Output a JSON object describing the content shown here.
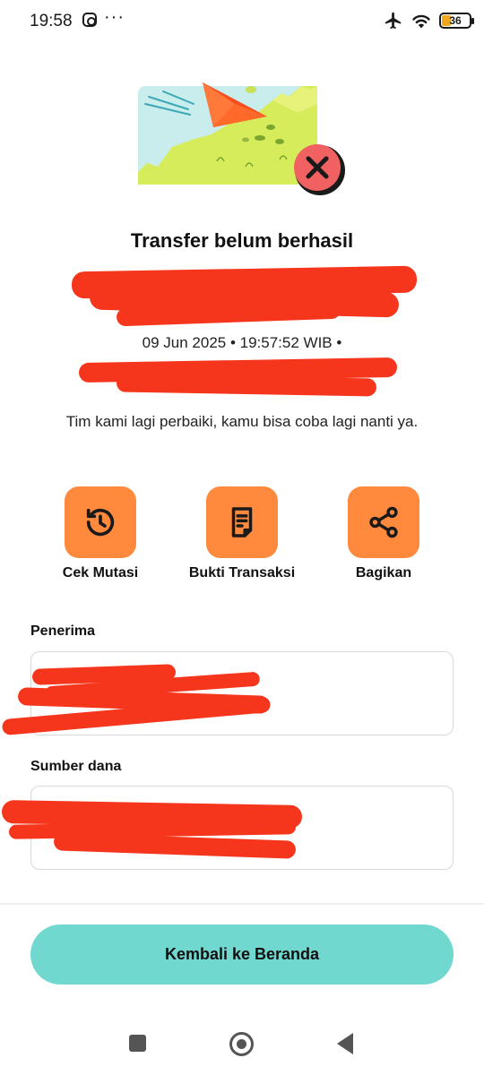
{
  "status_bar": {
    "time": "19:58",
    "overflow": "···",
    "battery": "36",
    "icons": [
      "instagram-icon",
      "airplane-mode-icon",
      "wifi-icon",
      "battery-icon"
    ]
  },
  "result": {
    "title": "Transfer belum berhasil",
    "datetime": "09 Jun 2025 • 19:57:52 WIB •",
    "message": "Tim kami lagi perbaiki, kamu bisa coba lagi nanti ya.",
    "status_icon": "close-icon"
  },
  "actions": [
    {
      "label": "Cek Mutasi",
      "icon": "history-icon"
    },
    {
      "label": "Bukti Transaksi",
      "icon": "receipt-icon"
    },
    {
      "label": "Bagikan",
      "icon": "share-icon"
    }
  ],
  "recipient": {
    "label": "Penerima"
  },
  "source": {
    "label": "Sumber dana"
  },
  "home_button": "Kembali ke Beranda",
  "colors": {
    "accent_orange": "#ff8a3d",
    "primary_teal": "#71d8d0",
    "redaction_red": "#f5361c",
    "error_red": "#f26161"
  }
}
